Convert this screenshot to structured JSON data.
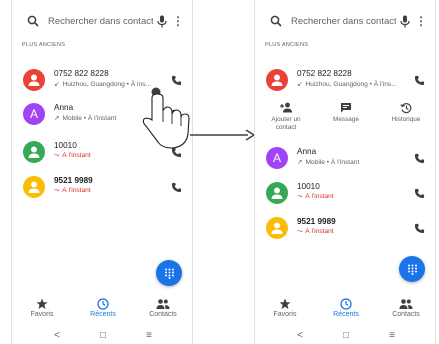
{
  "search": {
    "placeholder": "Rechercher dans contacts"
  },
  "section_header": "PLUS ANCIENS",
  "calls": [
    {
      "number": "0752 822 8228",
      "detail": "Huizhou, Guangdong • À ins...",
      "detail_full": "Huizhou, Guangdong • À l'ins...",
      "type": "outgoing-icon",
      "avatar": "person-icon",
      "color": "#ea4335"
    },
    {
      "name": "Anna",
      "detail": "Mobile • À l'instant",
      "type": "outgoing-icon",
      "avatar_letter": "A",
      "color": "#a142f4"
    },
    {
      "number": "10010",
      "detail": "À l'instant",
      "type": "missed-icon",
      "avatar": "person-icon",
      "color": "#34a853"
    },
    {
      "number": "9521 9989",
      "detail": "À l'instant",
      "type": "missed-icon",
      "avatar": "person-icon",
      "color": "#fbbc04"
    }
  ],
  "actions": {
    "add_contact": "Ajouter un contact",
    "message": "Message",
    "history": "Historique"
  },
  "nav": {
    "favorites": "Favoris",
    "recents": "Récents",
    "contacts": "Contacts"
  },
  "system": {
    "back": "<",
    "home": "□",
    "recents": "≡"
  },
  "colors": {
    "accent": "#1a73e8",
    "missed": "#d93025"
  }
}
